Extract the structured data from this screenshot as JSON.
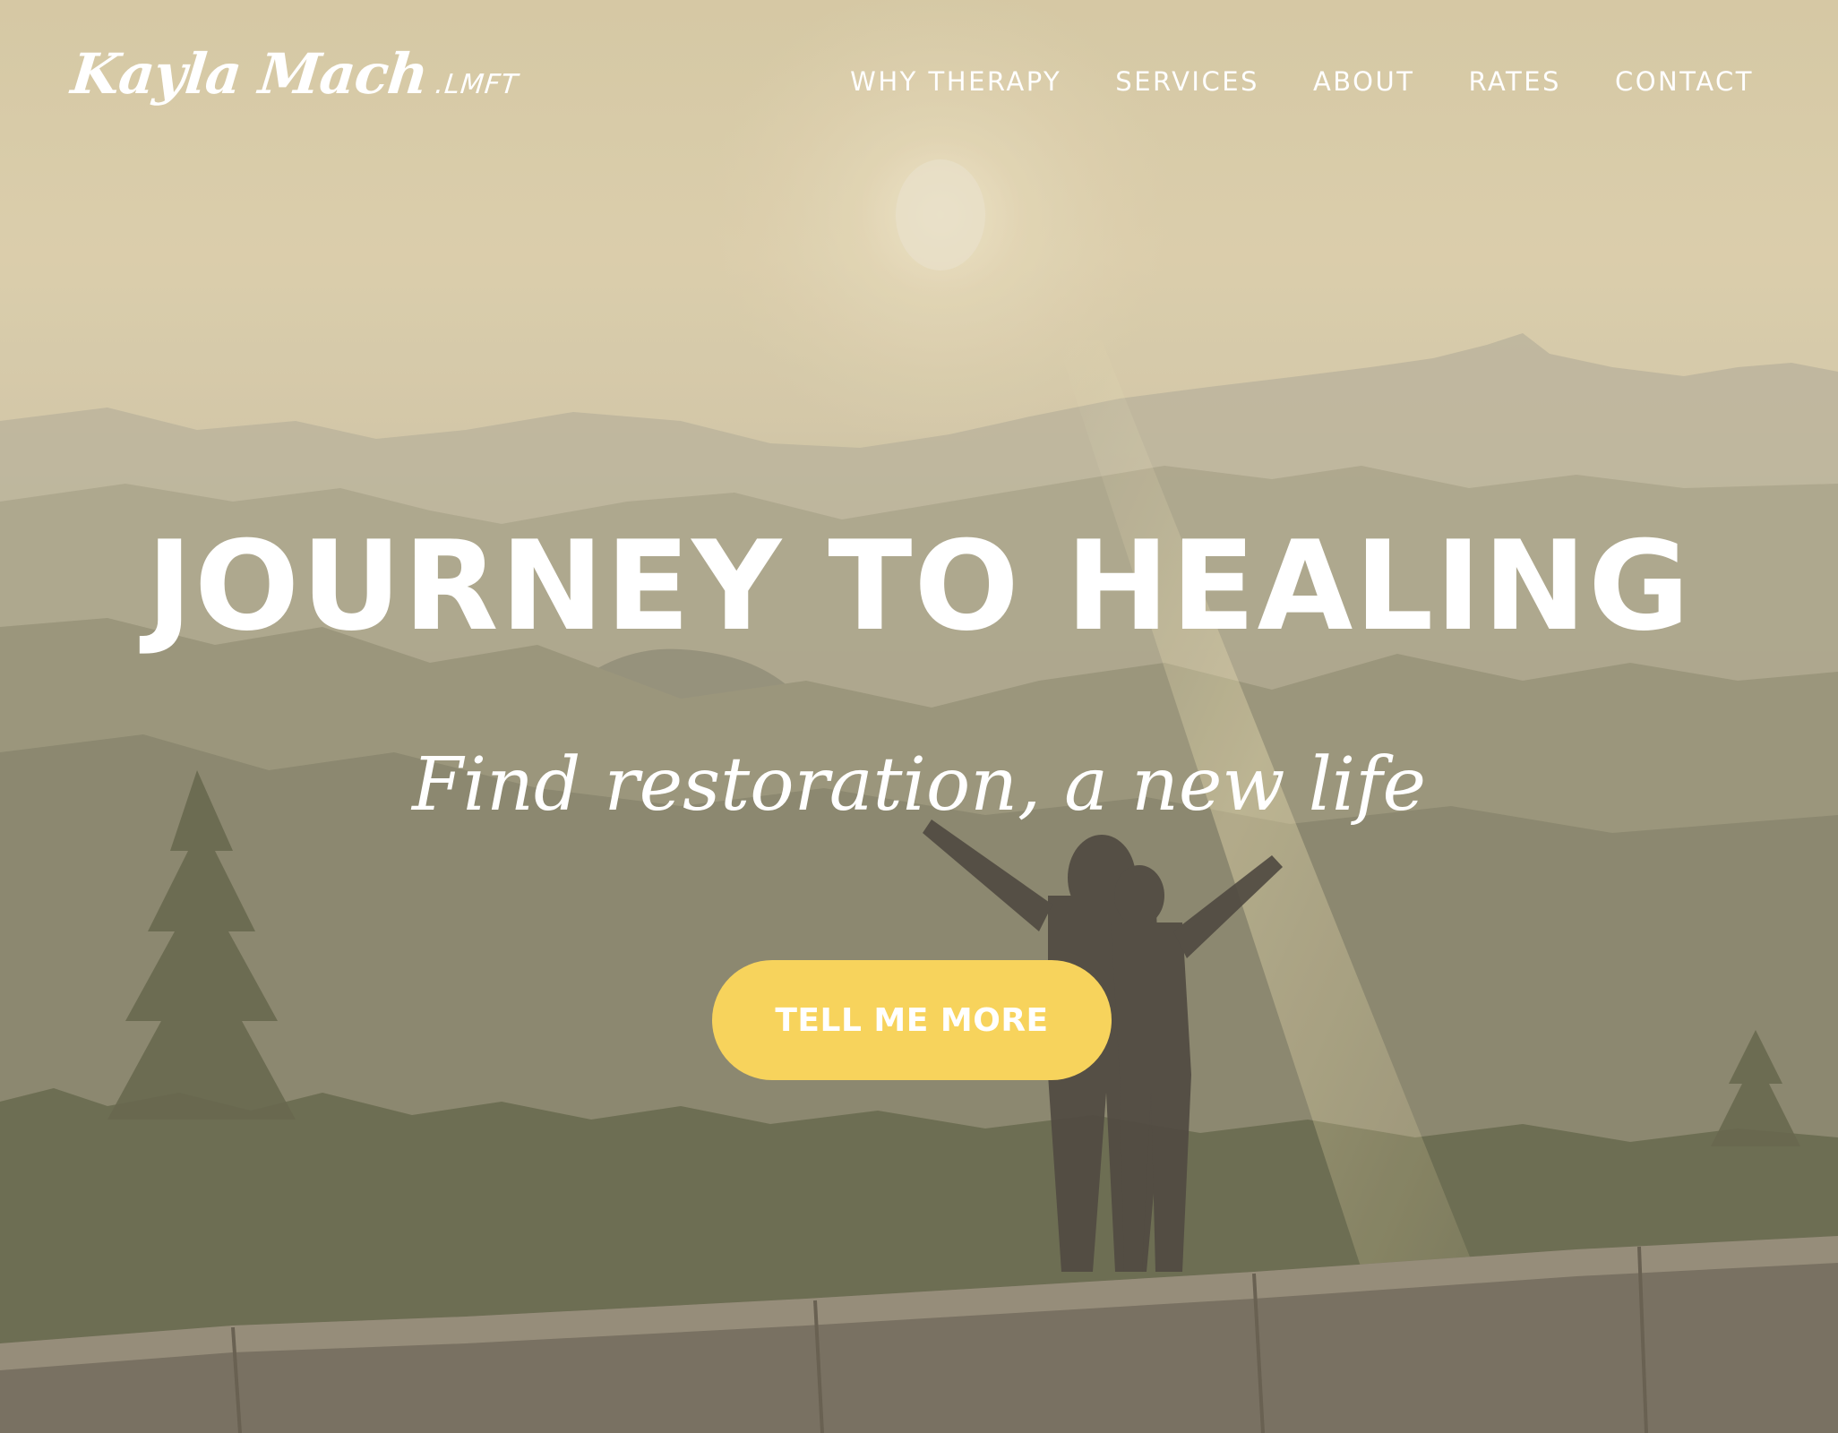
{
  "header": {
    "logo_name": "Kayla Mach",
    "logo_suffix": ".LMFT",
    "nav": [
      {
        "label": "WHY THERAPY"
      },
      {
        "label": "SERVICES"
      },
      {
        "label": "ABOUT"
      },
      {
        "label": "RATES"
      },
      {
        "label": "CONTACT"
      }
    ]
  },
  "hero": {
    "headline": "JOURNEY TO HEALING",
    "subheadline": "Find restoration, a new life",
    "cta_label": "TELL ME MORE",
    "cta_color": "#f7d35c"
  }
}
